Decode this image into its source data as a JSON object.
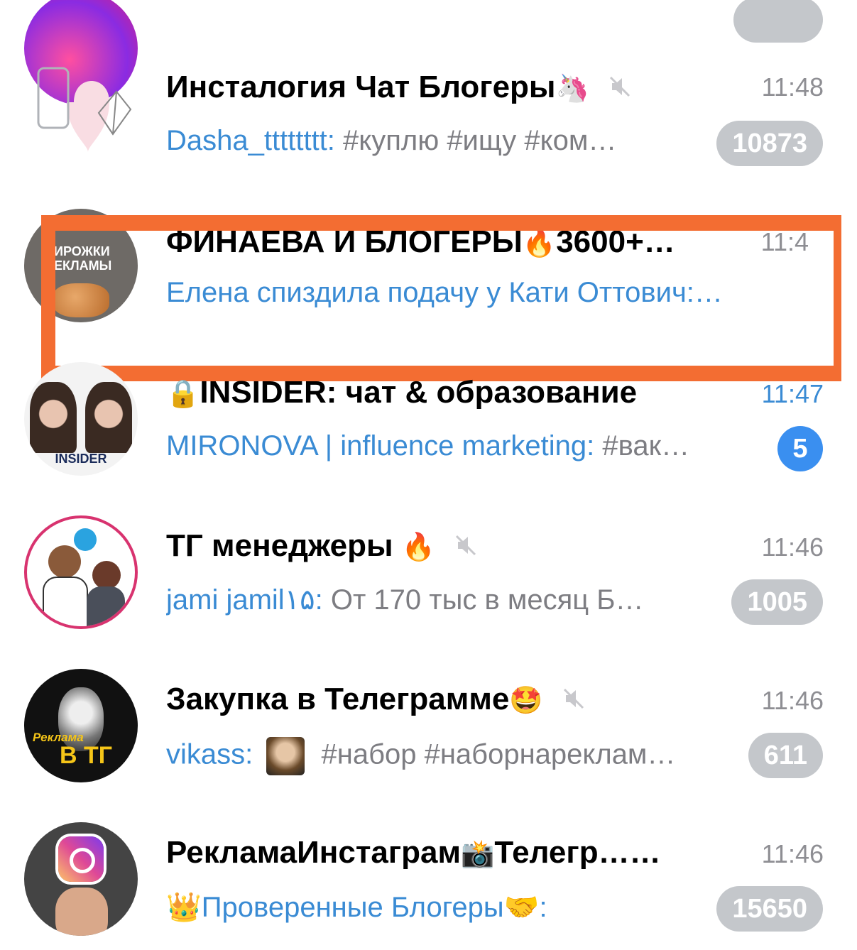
{
  "top_partial": {
    "badge": ""
  },
  "chats": [
    {
      "title": "Инсталогия Чат Блогеры",
      "title_emoji": "🦄",
      "muted": true,
      "time": "11:48",
      "sender": "Dasha_tttttttt:",
      "message": " #куплю #ищу #ком…",
      "badge": "10873"
    },
    {
      "title": "ФИНАЕВА И БЛОГЕРЫ",
      "title_emoji": "🔥",
      "title_suffix": "3600+…",
      "time": "11:4",
      "sender": "Елена спиздила подачу у Кати Оттович:…",
      "message": "",
      "avatar_text_line1": "ИРОЖКИ",
      "avatar_text_line2": "ЕКЛАМЫ"
    },
    {
      "title_emoji": "🔒",
      "title": "INSIDER: чат & образование",
      "time": "11:47",
      "sender": "MIRONOVA | influence marketing:",
      "message": " #вак…",
      "badge": "5",
      "avatar_label": "INSIDER"
    },
    {
      "title": "ТГ менеджеры ",
      "title_emoji": "🔥",
      "muted": true,
      "time": "11:46",
      "sender": "jami jamil۱۵:",
      "message": " От 170 тыс в месяц Б…",
      "badge": "1005"
    },
    {
      "title": "Закупка в Телеграмме",
      "title_emoji": "🤩",
      "muted": true,
      "time": "11:46",
      "sender": "vikass:",
      "message": " #набор #наборнареклам…",
      "badge": "611",
      "avatar_text_line1": "Реклама",
      "avatar_text_line2": "В ТГ"
    },
    {
      "title": "РекламаИнстаграм",
      "title_emoji": "📸",
      "title_suffix": "Телегр…",
      "muted": true,
      "time": "11:46",
      "sender": "👑Проверенные Блогеры🤝:",
      "message": "",
      "badge": "15650"
    }
  ],
  "colors": {
    "accent": "#3a8bd4",
    "highlight": "#f36d32",
    "badge_muted": "#c4c7cb",
    "badge_active": "#3a8ff0"
  }
}
